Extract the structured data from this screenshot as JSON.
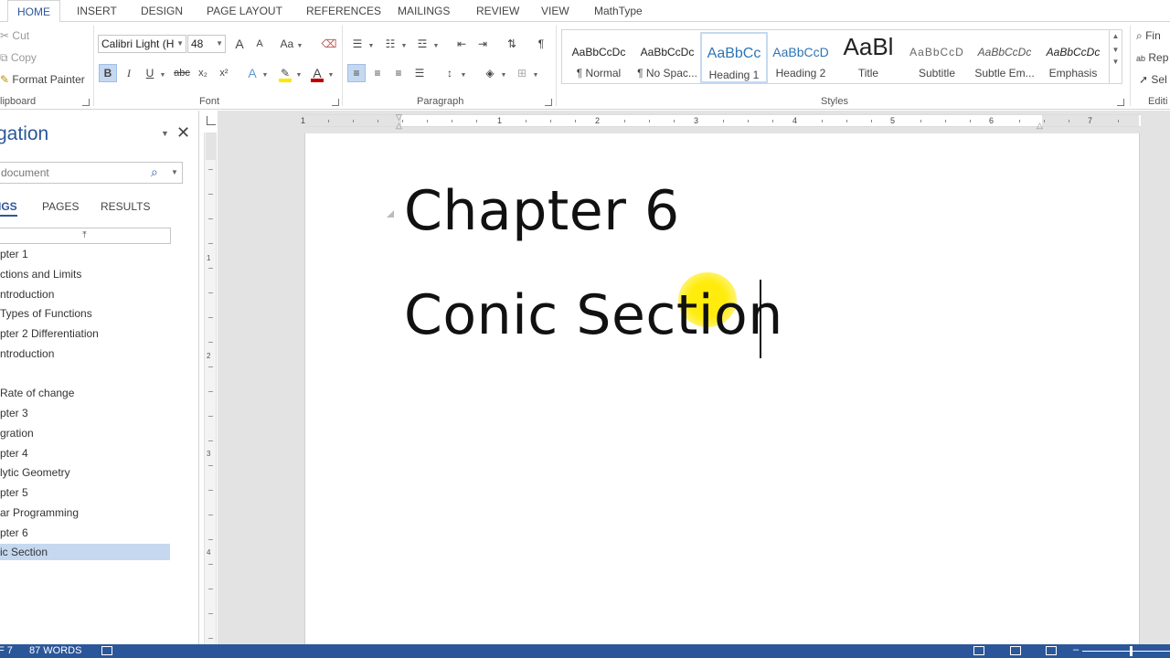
{
  "tabs": [
    {
      "label": "HOME",
      "active": true
    },
    {
      "label": "INSERT"
    },
    {
      "label": "DESIGN"
    },
    {
      "label": "PAGE LAYOUT"
    },
    {
      "label": "REFERENCES"
    },
    {
      "label": "MAILINGS"
    },
    {
      "label": "REVIEW"
    },
    {
      "label": "VIEW"
    },
    {
      "label": "MathType"
    }
  ],
  "clipboard": {
    "cut": "Cut",
    "copy": "Copy",
    "format_painter": "Format Painter",
    "group_label": "lipboard"
  },
  "font": {
    "family": "Calibri Light (H",
    "size": "48",
    "group_label": "Font",
    "bold": "B",
    "italic": "I",
    "underline": "U",
    "strike": "abc",
    "subscript": "x₂",
    "superscript": "x²",
    "font_color_letter": "A",
    "grow": "A",
    "shrink": "A",
    "case": "Aa",
    "highlight_color": "#ffe600",
    "font_color": "#c00000"
  },
  "paragraph": {
    "group_label": "Paragraph",
    "pilcrow": "¶"
  },
  "styles": {
    "group_label": "Styles",
    "items": [
      {
        "preview": "AaBbCcDc",
        "name": "¶ Normal"
      },
      {
        "preview": "AaBbCcDc",
        "name": "¶ No Spac..."
      },
      {
        "preview": "AaBbCc",
        "name": "Heading 1",
        "selected": true
      },
      {
        "preview": "AaBbCcD",
        "name": "Heading 2"
      },
      {
        "preview": "AaBl",
        "name": "Title"
      },
      {
        "preview": "AaBbCcD",
        "name": "Subtitle"
      },
      {
        "preview": "AaBbCcDc",
        "name": "Subtle Em..."
      },
      {
        "preview": "AaBbCcDc",
        "name": "Emphasis"
      }
    ]
  },
  "editing": {
    "find": "Fin",
    "replace": "Rep",
    "select": "Sel",
    "group_label": "Editi"
  },
  "navigation": {
    "title": "gation",
    "search_placeholder": "document",
    "tabs": [
      "IGS",
      "PAGES",
      "RESULTS"
    ],
    "headings": [
      "pter 1",
      "ctions and Limits",
      "ntroduction",
      "Types of Functions",
      "pter 2 Differentiation",
      "ntroduction",
      "",
      "Rate of change",
      "pter 3",
      "gration",
      "pter 4",
      "lytic Geometry",
      "pter 5",
      "ar Programming",
      "pter 6",
      "ic Section"
    ],
    "selected_index": 15
  },
  "ruler": {
    "h_numbers": [
      "1",
      "1",
      "2",
      "3",
      "4",
      "5",
      "6",
      "7"
    ],
    "v_numbers": [
      "1",
      "2",
      "3",
      "4"
    ]
  },
  "document": {
    "line1": "Chapter 6",
    "line2": "Conic Section"
  },
  "status": {
    "page": "F 7",
    "words": "87 WORDS"
  }
}
